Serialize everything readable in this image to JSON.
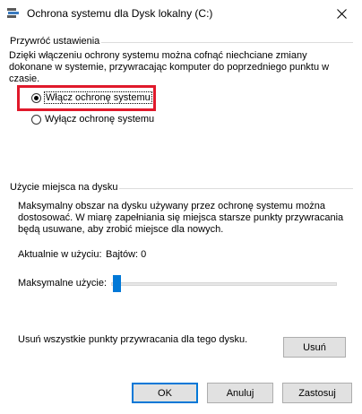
{
  "window": {
    "title": "Ochrona systemu dla Dysk lokalny (C:)"
  },
  "restore_settings": {
    "group_title": "Przywróć ustawienia",
    "description_lines": [
      "Dzięki włączeniu ochrony systemu można cofnąć niechciane zmiany",
      "dokonane w systemie, przywracając komputer do poprzedniego punktu w",
      "czasie."
    ],
    "options": [
      {
        "label": "Włącz ochronę systemu",
        "checked": true
      },
      {
        "label": "Wyłącz ochronę systemu",
        "checked": false
      }
    ]
  },
  "disk_usage": {
    "group_title": "Użycie miejsca na dysku",
    "description_lines": [
      "Maksymalny obszar na dysku używany przez ochronę systemu można",
      "dostosować. W miarę zapełniania się miejsca starsze punkty przywracania",
      "będą usuwane, aby zrobić miejsce dla nowych."
    ],
    "current_usage_label": "Aktualnie w użyciu:",
    "current_usage_value": "Bajtów: 0",
    "max_usage_label": "Maksymalne użycie:",
    "max_usage_fraction": 0.0,
    "delete_text": "Usuń wszystkie punkty przywracania dla tego dysku.",
    "delete_button": "Usuń"
  },
  "buttons": {
    "ok": "OK",
    "cancel": "Anuluj",
    "apply": "Zastosuj"
  },
  "colors": {
    "highlight": "#e0192b",
    "slider_thumb": "#0078d7"
  }
}
